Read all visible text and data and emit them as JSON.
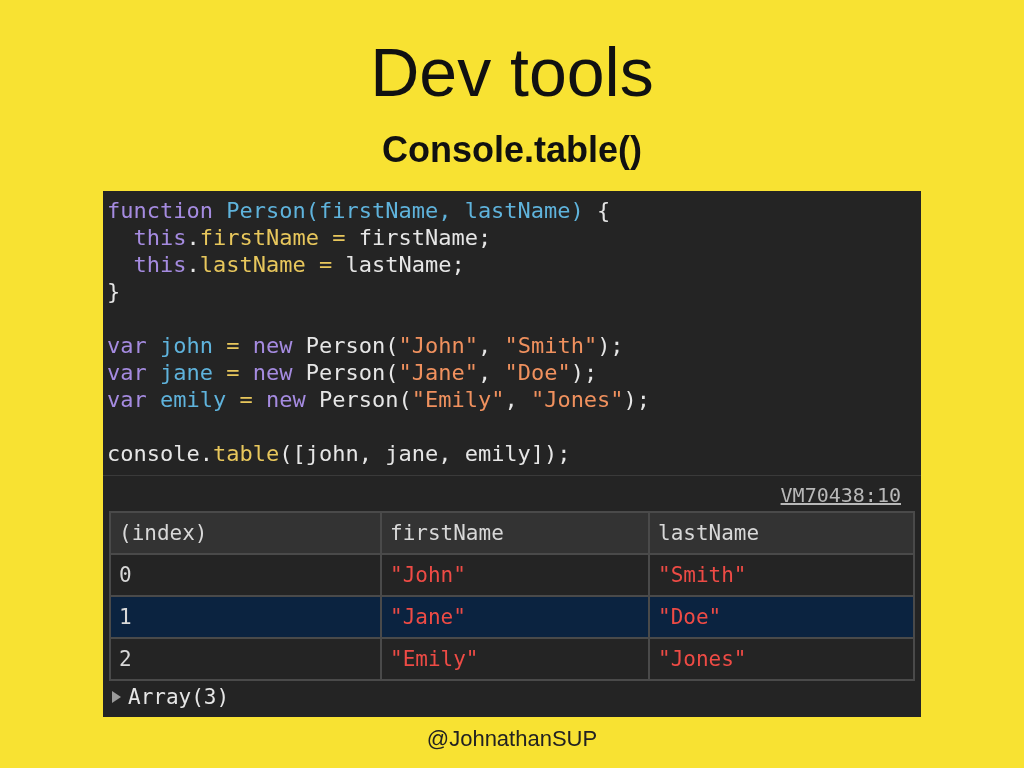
{
  "slide": {
    "title": "Dev tools",
    "subtitle": "Console.table()",
    "footer": "@JohnathanSUP"
  },
  "code_blocks": [
    {
      "lines": [
        [
          {
            "kind": "keyword",
            "text": "function "
          },
          {
            "kind": "def",
            "text": "Person(firstName, lastName) "
          },
          {
            "kind": "plain",
            "text": "{"
          }
        ],
        [
          {
            "kind": "keyword",
            "text": "  this"
          },
          {
            "kind": "plain",
            "text": "."
          },
          {
            "kind": "prop",
            "text": "firstName = "
          },
          {
            "kind": "plain",
            "text": "firstName;"
          }
        ],
        [
          {
            "kind": "keyword",
            "text": "  this"
          },
          {
            "kind": "plain",
            "text": "."
          },
          {
            "kind": "prop",
            "text": "lastName = "
          },
          {
            "kind": "plain",
            "text": "lastName;"
          }
        ],
        [
          {
            "kind": "plain",
            "text": "}"
          }
        ]
      ]
    },
    {
      "lines": [
        [
          {
            "kind": "keyword",
            "text": "var "
          },
          {
            "kind": "def",
            "text": "john "
          },
          {
            "kind": "prop",
            "text": "= "
          },
          {
            "kind": "keyword",
            "text": "new "
          },
          {
            "kind": "plain",
            "text": "Person("
          },
          {
            "kind": "string",
            "text": "\"John\""
          },
          {
            "kind": "plain",
            "text": ", "
          },
          {
            "kind": "string",
            "text": "\"Smith\""
          },
          {
            "kind": "plain",
            "text": ");"
          }
        ],
        [
          {
            "kind": "keyword",
            "text": "var "
          },
          {
            "kind": "def",
            "text": "jane "
          },
          {
            "kind": "prop",
            "text": "= "
          },
          {
            "kind": "keyword",
            "text": "new "
          },
          {
            "kind": "plain",
            "text": "Person("
          },
          {
            "kind": "string",
            "text": "\"Jane\""
          },
          {
            "kind": "plain",
            "text": ", "
          },
          {
            "kind": "string",
            "text": "\"Doe\""
          },
          {
            "kind": "plain",
            "text": ");"
          }
        ],
        [
          {
            "kind": "keyword",
            "text": "var "
          },
          {
            "kind": "def",
            "text": "emily "
          },
          {
            "kind": "prop",
            "text": "= "
          },
          {
            "kind": "keyword",
            "text": "new "
          },
          {
            "kind": "plain",
            "text": "Person("
          },
          {
            "kind": "string",
            "text": "\"Emily\""
          },
          {
            "kind": "plain",
            "text": ", "
          },
          {
            "kind": "string",
            "text": "\"Jones\""
          },
          {
            "kind": "plain",
            "text": ");"
          }
        ]
      ]
    },
    {
      "lines": [
        [
          {
            "kind": "plain",
            "text": "console."
          },
          {
            "kind": "prop",
            "text": "table"
          },
          {
            "kind": "plain",
            "text": "([john, jane, emily]);"
          }
        ]
      ]
    }
  ],
  "console": {
    "source_link": "VM70438:10",
    "table": {
      "columns": [
        "(index)",
        "firstName",
        "lastName"
      ],
      "rows": [
        {
          "selected": false,
          "cells": [
            "0",
            "\"John\"",
            "\"Smith\""
          ]
        },
        {
          "selected": true,
          "cells": [
            "1",
            "\"Jane\"",
            "\"Doe\""
          ]
        },
        {
          "selected": false,
          "cells": [
            "2",
            "\"Emily\"",
            "\"Jones\""
          ]
        }
      ]
    },
    "result": {
      "label": "Array(3)",
      "expanded": false
    }
  }
}
